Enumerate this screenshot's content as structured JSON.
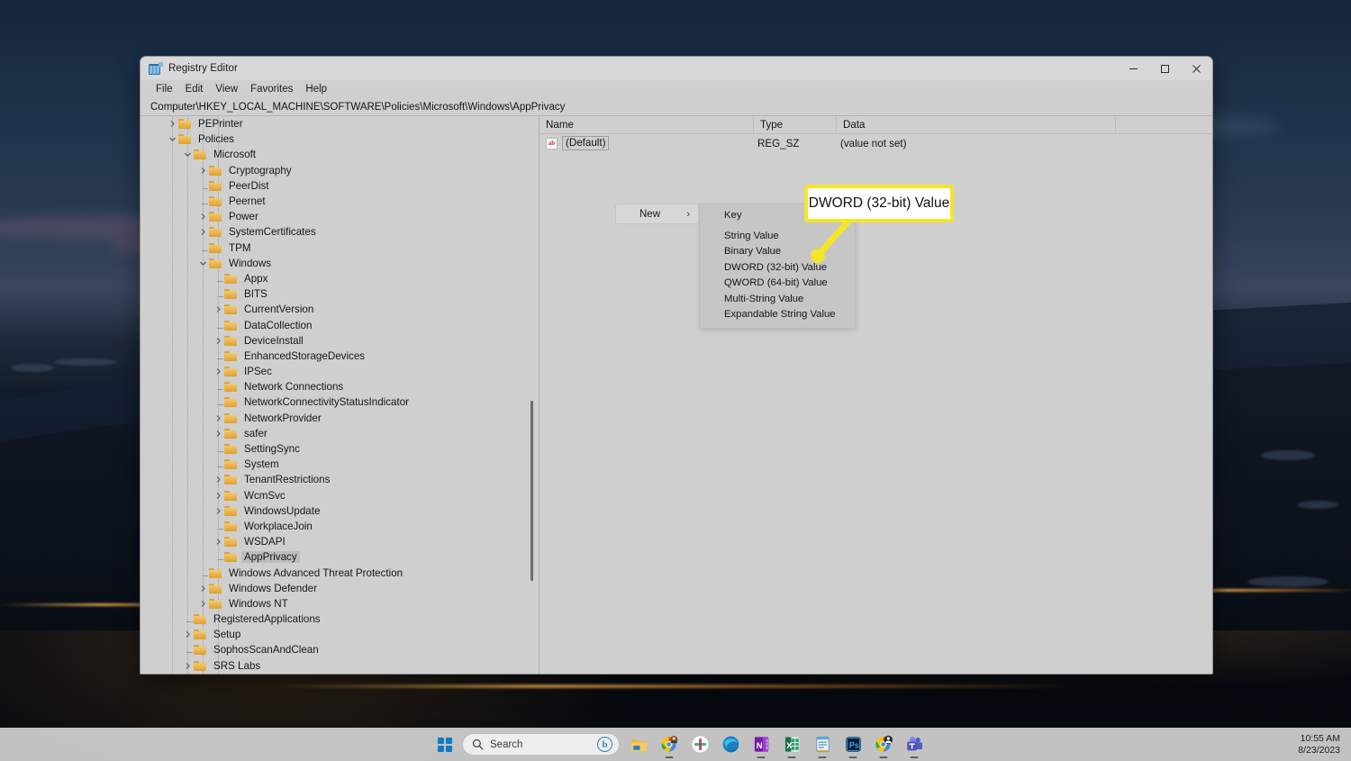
{
  "window": {
    "title": "Registry Editor",
    "icon": "registry-editor-icon",
    "controls": {
      "minimize": "–",
      "maximize": "☐",
      "close": "✕"
    },
    "menubar": [
      "File",
      "Edit",
      "View",
      "Favorites",
      "Help"
    ],
    "address": "Computer\\HKEY_LOCAL_MACHINE\\SOFTWARE\\Policies\\Microsoft\\Windows\\AppPrivacy"
  },
  "tree": {
    "items": [
      {
        "label": "PEPrinter",
        "depth": 1,
        "state": "collapsed"
      },
      {
        "label": "Policies",
        "depth": 1,
        "state": "expanded"
      },
      {
        "label": "Microsoft",
        "depth": 2,
        "state": "expanded"
      },
      {
        "label": "Cryptography",
        "depth": 3,
        "state": "collapsed"
      },
      {
        "label": "PeerDist",
        "depth": 3,
        "state": "leaf"
      },
      {
        "label": "Peernet",
        "depth": 3,
        "state": "leaf"
      },
      {
        "label": "Power",
        "depth": 3,
        "state": "collapsed"
      },
      {
        "label": "SystemCertificates",
        "depth": 3,
        "state": "collapsed"
      },
      {
        "label": "TPM",
        "depth": 3,
        "state": "leaf"
      },
      {
        "label": "Windows",
        "depth": 3,
        "state": "expanded"
      },
      {
        "label": "Appx",
        "depth": 4,
        "state": "leaf"
      },
      {
        "label": "BITS",
        "depth": 4,
        "state": "leaf"
      },
      {
        "label": "CurrentVersion",
        "depth": 4,
        "state": "collapsed"
      },
      {
        "label": "DataCollection",
        "depth": 4,
        "state": "leaf"
      },
      {
        "label": "DeviceInstall",
        "depth": 4,
        "state": "collapsed"
      },
      {
        "label": "EnhancedStorageDevices",
        "depth": 4,
        "state": "leaf"
      },
      {
        "label": "IPSec",
        "depth": 4,
        "state": "collapsed"
      },
      {
        "label": "Network Connections",
        "depth": 4,
        "state": "leaf"
      },
      {
        "label": "NetworkConnectivityStatusIndicator",
        "depth": 4,
        "state": "leaf"
      },
      {
        "label": "NetworkProvider",
        "depth": 4,
        "state": "collapsed"
      },
      {
        "label": "safer",
        "depth": 4,
        "state": "collapsed"
      },
      {
        "label": "SettingSync",
        "depth": 4,
        "state": "leaf"
      },
      {
        "label": "System",
        "depth": 4,
        "state": "leaf"
      },
      {
        "label": "TenantRestrictions",
        "depth": 4,
        "state": "collapsed"
      },
      {
        "label": "WcmSvc",
        "depth": 4,
        "state": "collapsed"
      },
      {
        "label": "WindowsUpdate",
        "depth": 4,
        "state": "collapsed"
      },
      {
        "label": "WorkplaceJoin",
        "depth": 4,
        "state": "leaf"
      },
      {
        "label": "WSDAPI",
        "depth": 4,
        "state": "collapsed"
      },
      {
        "label": "AppPrivacy",
        "depth": 4,
        "state": "leaf",
        "selected": true
      },
      {
        "label": "Windows Advanced Threat Protection",
        "depth": 3,
        "state": "leaf"
      },
      {
        "label": "Windows Defender",
        "depth": 3,
        "state": "collapsed"
      },
      {
        "label": "Windows NT",
        "depth": 3,
        "state": "collapsed"
      },
      {
        "label": "RegisteredApplications",
        "depth": 2,
        "state": "leaf"
      },
      {
        "label": "Setup",
        "depth": 2,
        "state": "collapsed"
      },
      {
        "label": "SophosScanAndClean",
        "depth": 2,
        "state": "leaf"
      },
      {
        "label": "SRS Labs",
        "depth": 2,
        "state": "collapsed"
      }
    ]
  },
  "list": {
    "columns": [
      "Name",
      "Type",
      "Data"
    ],
    "rows": [
      {
        "icon": "ab",
        "name": "(Default)",
        "type": "REG_SZ",
        "data": "(value not set)"
      }
    ]
  },
  "context_menu": {
    "parent_label": "New",
    "parent_arrow": "›",
    "items": [
      "Key",
      "String Value",
      "Binary Value",
      "DWORD (32-bit) Value",
      "QWORD (64-bit) Value",
      "Multi-String Value",
      "Expandable String Value"
    ]
  },
  "callout": {
    "text": "DWORD (32-bit) Value",
    "border_color": "#f5e52a",
    "fill_color": "#ffffff"
  },
  "taskbar": {
    "search_placeholder": "Search",
    "bing_badge": "b",
    "clock_time": "10:55 AM",
    "clock_date": "8/23/2023",
    "apps": [
      {
        "name": "file-explorer-icon",
        "running": false
      },
      {
        "name": "chrome-profile-icon",
        "running": true
      },
      {
        "name": "slack-icon",
        "running": false
      },
      {
        "name": "microsoft-edge-icon",
        "running": false
      },
      {
        "name": "onenote-icon",
        "running": true
      },
      {
        "name": "excel-icon",
        "running": true
      },
      {
        "name": "notepad-icon",
        "running": true
      },
      {
        "name": "photoshop-icon",
        "running": true
      },
      {
        "name": "chrome-account-icon",
        "running": true
      },
      {
        "name": "teams-icon",
        "running": true
      }
    ]
  }
}
